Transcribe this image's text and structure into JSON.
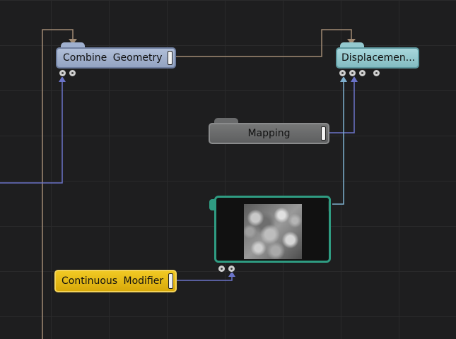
{
  "graph": {
    "nodes": {
      "combine_geometry": {
        "label": "Combine Geometry",
        "color": "#9fb0cf"
      },
      "displacement": {
        "label": "Displacemen...",
        "color": "#94c9cf"
      },
      "mapping": {
        "label": "Mapping",
        "color": "#6a6b6c"
      },
      "texture": {
        "label": "",
        "color": "#2f9c82"
      },
      "continuous_modifier": {
        "label": "Continuous Modifier",
        "color": "#e8bb12"
      }
    },
    "wire_colors": {
      "tan": "#a08a74",
      "blue": "#6b74c9",
      "lightblue": "#7fb0cf"
    }
  }
}
